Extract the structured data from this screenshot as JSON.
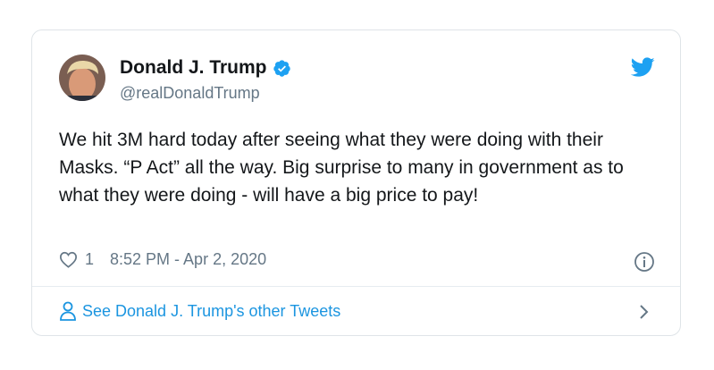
{
  "tweet": {
    "author_name": "Donald J. Trump",
    "handle": "@realDonaldTrump",
    "text": "We hit 3M hard today after seeing what they were doing with their Masks. “P Act” all the way. Big surprise to many in government as to what they were doing - will have a big price to pay!",
    "like_count": "1",
    "timestamp": "8:52 PM - Apr 2, 2020"
  },
  "footer": {
    "link_label": "See Donald J. Trump's other Tweets"
  },
  "icons": {
    "verified": "verified-badge-icon",
    "twitter": "twitter-bird-icon",
    "like": "heart-icon",
    "info": "info-icon",
    "profile": "person-icon",
    "chevron": "chevron-right-icon"
  },
  "colors": {
    "brand_blue": "#1da1f2",
    "link_blue": "#1b95e0",
    "text": "#14171a",
    "secondary_text": "#657786",
    "border": "#dfe4e8"
  }
}
